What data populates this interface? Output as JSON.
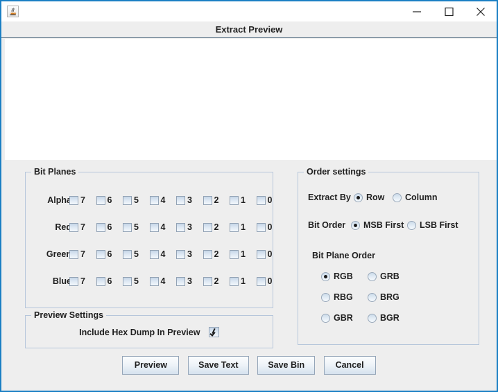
{
  "window": {
    "title": "",
    "icon": "java-coffee-cup-icon",
    "controls": {
      "minimize": "minimize-icon",
      "maximize": "maximize-icon",
      "close": "close-icon"
    },
    "frame_title": "Extract Preview",
    "accent_color": "#1b7fc4",
    "background_color": "#eeeeee"
  },
  "preview": {
    "content": "",
    "background_color": "#ffffff"
  },
  "bit_planes": {
    "group_title": "Bit Planes",
    "bits": [
      "7",
      "6",
      "5",
      "4",
      "3",
      "2",
      "1",
      "0"
    ],
    "rows": [
      {
        "label": "Alpha",
        "checked": [
          false,
          false,
          false,
          false,
          false,
          false,
          false,
          false
        ]
      },
      {
        "label": "Red",
        "checked": [
          false,
          false,
          false,
          false,
          false,
          false,
          false,
          false
        ]
      },
      {
        "label": "Green",
        "checked": [
          false,
          false,
          false,
          false,
          false,
          false,
          false,
          false
        ]
      },
      {
        "label": "Blue",
        "checked": [
          false,
          false,
          false,
          false,
          false,
          false,
          false,
          false
        ]
      }
    ]
  },
  "preview_settings": {
    "group_title": "Preview Settings",
    "hex_dump_label": "Include Hex Dump In Preview",
    "hex_dump_checked": true
  },
  "order_settings": {
    "group_title": "Order settings",
    "extract_by": {
      "label": "Extract By",
      "options": [
        "Row",
        "Column"
      ],
      "selected": "Row"
    },
    "bit_order": {
      "label": "Bit Order",
      "options": [
        "MSB First",
        "LSB First"
      ],
      "selected": "MSB First"
    },
    "bit_plane_order": {
      "label": "Bit Plane Order",
      "options": [
        "RGB",
        "GRB",
        "RBG",
        "BRG",
        "GBR",
        "BGR"
      ],
      "selected": "RGB"
    }
  },
  "buttons": {
    "preview": "Preview",
    "save_text": "Save Text",
    "save_bin": "Save Bin",
    "cancel": "Cancel"
  }
}
